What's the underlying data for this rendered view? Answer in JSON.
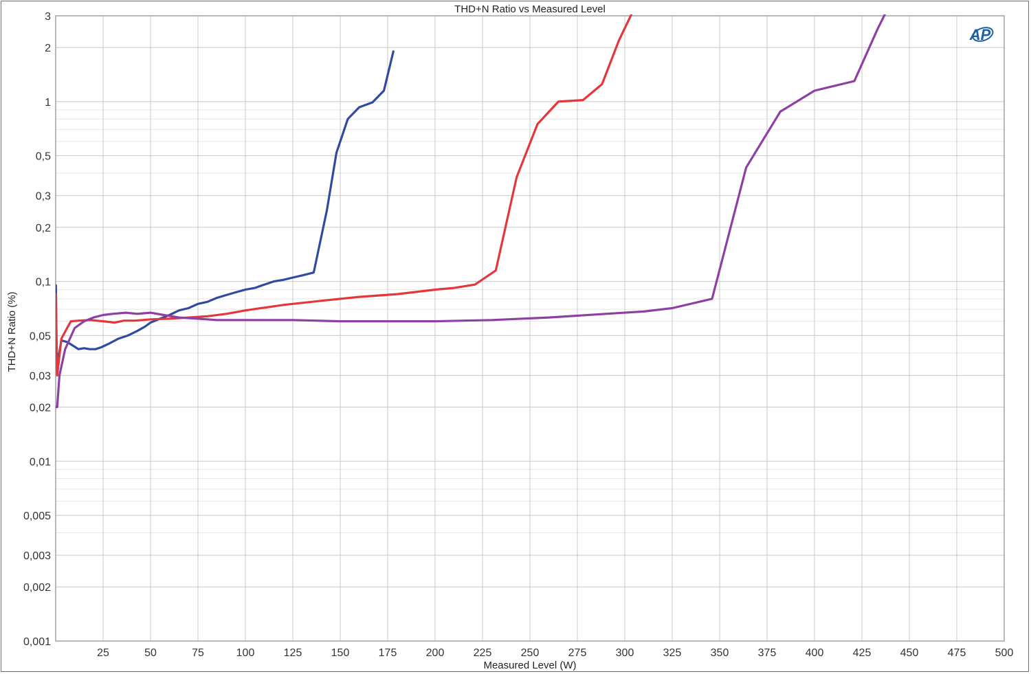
{
  "chart_data": {
    "type": "line",
    "title": "THD+N Ratio vs Measured Level",
    "xlabel": "Measured Level (W)",
    "ylabel": "THD+N Ratio (%)",
    "xlim": [
      0,
      500
    ],
    "ylim": [
      0.001,
      3
    ],
    "yscale": "log",
    "grid": true,
    "legend": "none",
    "logo": "AP",
    "x_ticks": [
      "25",
      "50",
      "75",
      "100",
      "125",
      "150",
      "175",
      "200",
      "225",
      "250",
      "275",
      "300",
      "325",
      "350",
      "375",
      "400",
      "425",
      "450",
      "475",
      "500"
    ],
    "y_ticks": [
      {
        "value": 3,
        "label": "3"
      },
      {
        "value": 2,
        "label": "2"
      },
      {
        "value": 1,
        "label": "1"
      },
      {
        "value": 0.5,
        "label": "0,5"
      },
      {
        "value": 0.3,
        "label": "0,3"
      },
      {
        "value": 0.2,
        "label": "0,2"
      },
      {
        "value": 0.1,
        "label": "0,1"
      },
      {
        "value": 0.05,
        "label": "0,05"
      },
      {
        "value": 0.03,
        "label": "0,03"
      },
      {
        "value": 0.02,
        "label": "0,02"
      },
      {
        "value": 0.01,
        "label": "0,01"
      },
      {
        "value": 0.005,
        "label": "0,005"
      },
      {
        "value": 0.003,
        "label": "0,003"
      },
      {
        "value": 0.002,
        "label": "0,002"
      },
      {
        "value": 0.001,
        "label": "0,001"
      }
    ],
    "series": [
      {
        "color": "#2f4aa0",
        "points": [
          [
            0.1,
            0.095
          ],
          [
            0.5,
            0.04
          ],
          [
            1.5,
            0.038
          ],
          [
            3,
            0.047
          ],
          [
            6,
            0.046
          ],
          [
            9,
            0.044
          ],
          [
            12,
            0.042
          ],
          [
            15,
            0.0425
          ],
          [
            18,
            0.042
          ],
          [
            21,
            0.042
          ],
          [
            24,
            0.043
          ],
          [
            28,
            0.045
          ],
          [
            33,
            0.048
          ],
          [
            38,
            0.05
          ],
          [
            43,
            0.053
          ],
          [
            47,
            0.056
          ],
          [
            50,
            0.059
          ],
          [
            55,
            0.062
          ],
          [
            60,
            0.065
          ],
          [
            65,
            0.069
          ],
          [
            70,
            0.071
          ],
          [
            75,
            0.075
          ],
          [
            80,
            0.077
          ],
          [
            85,
            0.081
          ],
          [
            90,
            0.084
          ],
          [
            95,
            0.087
          ],
          [
            100,
            0.09
          ],
          [
            105,
            0.092
          ],
          [
            110,
            0.096
          ],
          [
            115,
            0.1
          ],
          [
            120,
            0.102
          ],
          [
            125,
            0.105
          ],
          [
            130,
            0.108
          ],
          [
            136,
            0.112
          ],
          [
            143,
            0.25
          ],
          [
            148,
            0.52
          ],
          [
            154,
            0.8
          ],
          [
            160,
            0.93
          ],
          [
            167,
            0.99
          ],
          [
            173,
            1.15
          ],
          [
            178,
            1.9
          ]
        ]
      },
      {
        "color": "#e3373b",
        "points": [
          [
            0,
            0.085
          ],
          [
            0.8,
            0.03
          ],
          [
            3,
            0.048
          ],
          [
            6,
            0.055
          ],
          [
            8,
            0.06
          ],
          [
            12,
            0.0605
          ],
          [
            18,
            0.061
          ],
          [
            25,
            0.06
          ],
          [
            31,
            0.059
          ],
          [
            36,
            0.0605
          ],
          [
            42,
            0.0605
          ],
          [
            50,
            0.0615
          ],
          [
            60,
            0.062
          ],
          [
            70,
            0.063
          ],
          [
            80,
            0.064
          ],
          [
            90,
            0.066
          ],
          [
            100,
            0.069
          ],
          [
            120,
            0.074
          ],
          [
            140,
            0.078
          ],
          [
            160,
            0.082
          ],
          [
            180,
            0.085
          ],
          [
            200,
            0.09
          ],
          [
            210,
            0.092
          ],
          [
            221,
            0.096
          ],
          [
            232,
            0.115
          ],
          [
            243,
            0.38
          ],
          [
            254,
            0.75
          ],
          [
            265,
            1.0
          ],
          [
            278,
            1.02
          ],
          [
            288,
            1.25
          ],
          [
            297,
            2.2
          ],
          [
            305,
            3.3
          ]
        ]
      },
      {
        "color": "#8e3fa3",
        "points": [
          [
            0,
            0.02
          ],
          [
            0.8,
            0.02
          ],
          [
            2,
            0.03
          ],
          [
            5,
            0.042
          ],
          [
            10,
            0.055
          ],
          [
            15,
            0.06
          ],
          [
            20,
            0.063
          ],
          [
            25,
            0.065
          ],
          [
            30,
            0.066
          ],
          [
            37,
            0.067
          ],
          [
            43,
            0.066
          ],
          [
            50,
            0.067
          ],
          [
            57,
            0.065
          ],
          [
            65,
            0.063
          ],
          [
            75,
            0.062
          ],
          [
            85,
            0.061
          ],
          [
            100,
            0.061
          ],
          [
            125,
            0.061
          ],
          [
            150,
            0.06
          ],
          [
            175,
            0.06
          ],
          [
            200,
            0.06
          ],
          [
            230,
            0.061
          ],
          [
            260,
            0.063
          ],
          [
            290,
            0.066
          ],
          [
            310,
            0.068
          ],
          [
            325,
            0.071
          ],
          [
            346,
            0.08
          ],
          [
            364,
            0.43
          ],
          [
            382,
            0.88
          ],
          [
            400,
            1.15
          ],
          [
            421,
            1.3
          ],
          [
            433,
            2.5
          ],
          [
            438,
            3.2
          ]
        ]
      }
    ]
  }
}
